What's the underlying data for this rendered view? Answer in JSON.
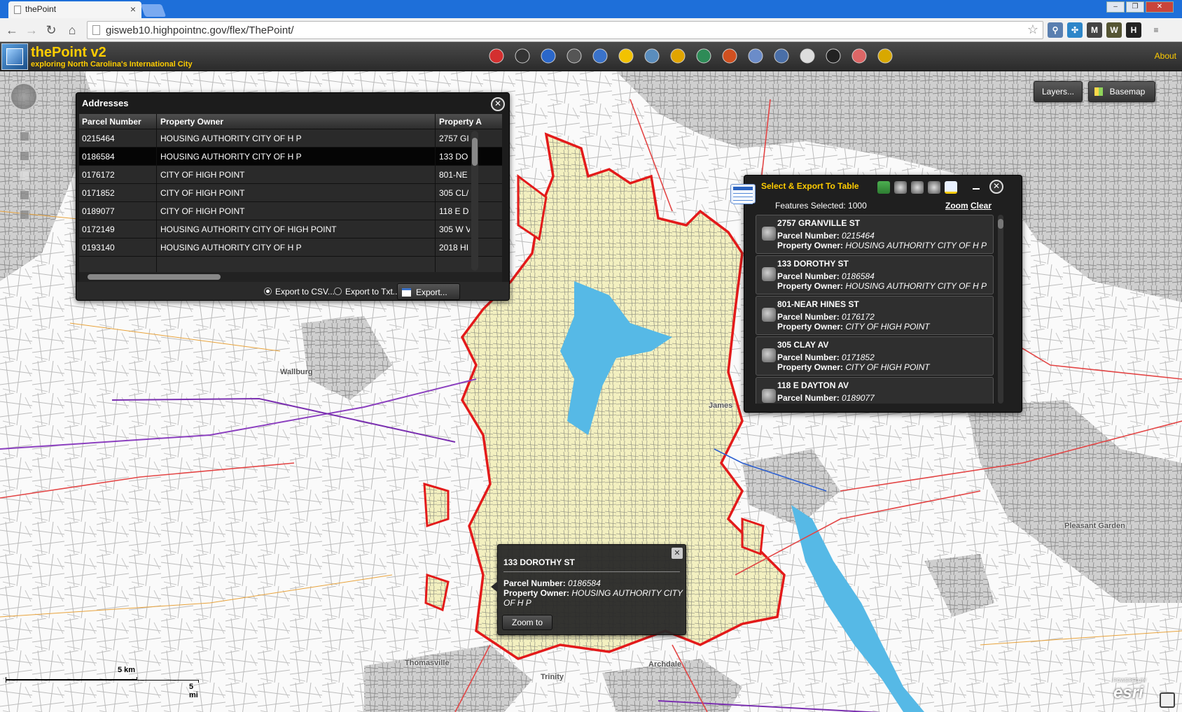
{
  "browser": {
    "tab_title": "thePoint",
    "url": "gisweb10.highpointnc.gov/flex/ThePoint/"
  },
  "app": {
    "title": "thePoint v2",
    "subtitle": "exploring North Carolina's International City",
    "about_label": "About",
    "accent_color": "#ffcc00"
  },
  "toolbar": {
    "tools": [
      "record-icon",
      "crosshair-icon",
      "info-icon",
      "select-icon",
      "table-icon",
      "pan-icon",
      "layers-stack-icon",
      "lock-icon",
      "globe-icon",
      "measure-icon",
      "draw-icon",
      "print-icon",
      "hand-pointer-icon",
      "download-icon",
      "report-icon",
      "key-icon"
    ]
  },
  "map_buttons": {
    "layers_label": "Layers...",
    "basemap_label": "Basemap"
  },
  "addresses": {
    "title": "Addresses",
    "columns": [
      "Parcel Number",
      "Property Owner",
      "Property A"
    ],
    "rows": [
      {
        "parcel": "0215464",
        "owner": "HOUSING AUTHORITY CITY OF H P",
        "addr": "2757 GI"
      },
      {
        "parcel": "0186584",
        "owner": "HOUSING AUTHORITY CITY OF H P",
        "addr": "133 DO"
      },
      {
        "parcel": "0176172",
        "owner": "CITY OF HIGH POINT",
        "addr": "801-NE"
      },
      {
        "parcel": "0171852",
        "owner": "CITY OF HIGH POINT",
        "addr": "305 CL/"
      },
      {
        "parcel": "0189077",
        "owner": "CITY OF HIGH POINT",
        "addr": "118 E D"
      },
      {
        "parcel": "0172149",
        "owner": "HOUSING AUTHORITY CITY OF HIGH POINT",
        "addr": "305 W V"
      },
      {
        "parcel": "0193140",
        "owner": "HOUSING AUTHORITY CITY OF H P",
        "addr": "2018 HI"
      }
    ],
    "export_csv_label": "Export to CSV...",
    "export_txt_label": "Export to Txt...",
    "export_button_label": "Export..."
  },
  "select_export": {
    "title": "Select & Export To Table",
    "features_selected": "Features Selected: 1000",
    "zoom_label": "Zoom",
    "clear_label": "Clear",
    "parcel_prefix": "Parcel Number:",
    "owner_prefix": "Property Owner:",
    "results": [
      {
        "address": "2757 GRANVILLE ST",
        "parcel": "0215464",
        "owner": "HOUSING AUTHORITY CITY OF H P"
      },
      {
        "address": "133 DOROTHY ST",
        "parcel": "0186584",
        "owner": "HOUSING AUTHORITY CITY OF H P"
      },
      {
        "address": "801-NEAR HINES ST",
        "parcel": "0176172",
        "owner": "CITY OF HIGH POINT"
      },
      {
        "address": "305 CLAY AV",
        "parcel": "0171852",
        "owner": "CITY OF HIGH POINT"
      },
      {
        "address": "118 E DAYTON AV",
        "parcel": "0189077",
        "owner": ""
      }
    ]
  },
  "popup": {
    "title": "133 DOROTHY ST",
    "parcel_label": "Parcel Number:",
    "parcel_value": "0186584",
    "owner_label": "Property Owner:",
    "owner_value": "HOUSING AUTHORITY CITY OF H P",
    "zoom_button": "Zoom to"
  },
  "map_labels": {
    "wallburg": "Wallburg",
    "jamestown": "James",
    "thomasville": "Thomasville",
    "archdale": "Archdale",
    "trinity": "Trinity",
    "pleasant_garden": "Pleasant Garden"
  },
  "scale": {
    "km_label": "5 km",
    "mi_label": "5 mi"
  },
  "attribution": "esri",
  "attribution_small": "POWERED BY"
}
